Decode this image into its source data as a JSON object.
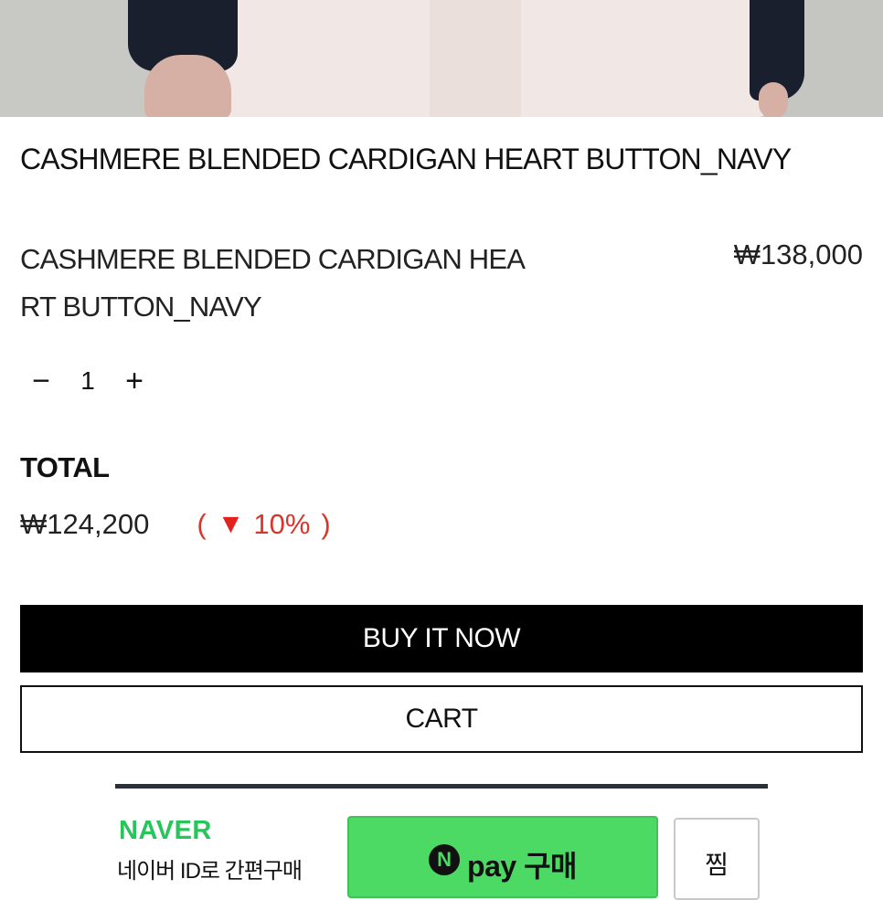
{
  "product": {
    "title": "CASHMERE BLENDED CARDIGAN HEART BUTTON_NAVY",
    "item_name": "CASHMERE BLENDED CARDIGAN HEART BUTTON_NAVY",
    "item_price": "₩138,000"
  },
  "quantity": {
    "minus": "−",
    "value": "1",
    "plus": "+"
  },
  "total": {
    "label": "TOTAL",
    "value": "₩124,200",
    "discount_open": "(",
    "discount_icon": "▼",
    "discount_value": "10%",
    "discount_close": ")"
  },
  "actions": {
    "buy_now": "BUY IT NOW",
    "cart": "CART"
  },
  "naver_pay": {
    "brand": "NAVER",
    "description": "네이버 ID로 간편구매",
    "n_logo": "N",
    "pay_label": "pay 구매",
    "zzim_label": "찜"
  },
  "colors": {
    "accent_red": "#e2221d",
    "naver_green": "#4cd964",
    "button_black": "#000000"
  }
}
